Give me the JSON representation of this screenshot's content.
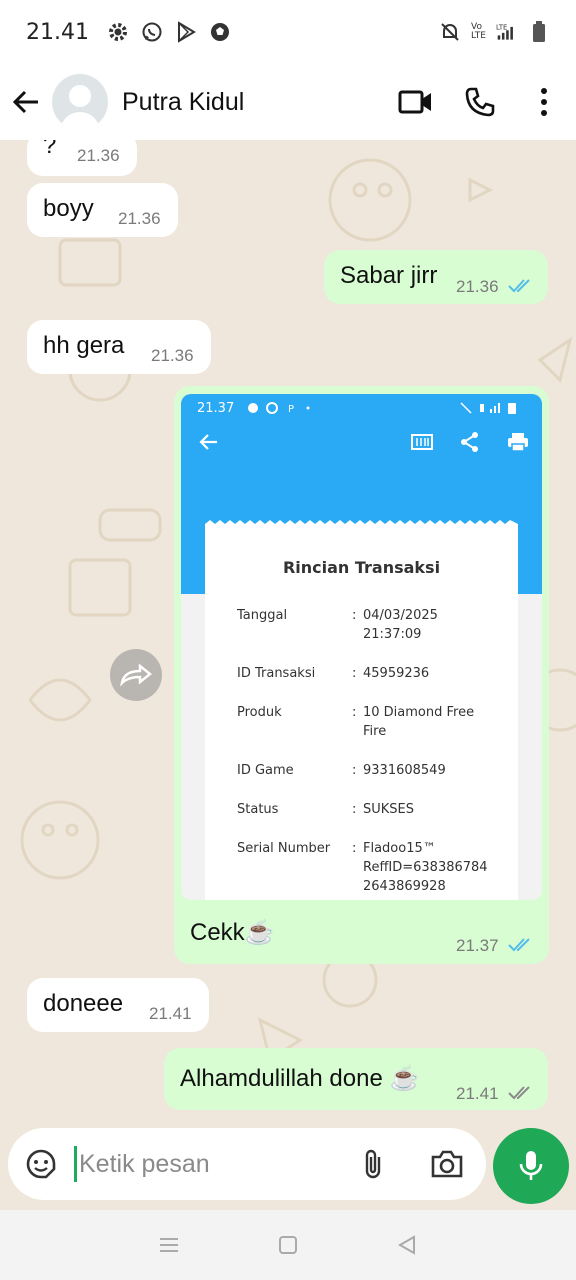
{
  "status_bar": {
    "time": "21.41",
    "lte_label": "Vo\nLTE",
    "lte2_label": "LTE"
  },
  "header": {
    "contact_name": "Putra Kidul"
  },
  "messages": [
    {
      "text": "?",
      "time": "21.36"
    },
    {
      "text": "boyy",
      "time": "21.36"
    },
    {
      "text": "Sabar jirr",
      "time": "21.36"
    },
    {
      "text": "hh gera",
      "time": "21.36"
    },
    {
      "text": "Cekk☕",
      "time": "21.37"
    },
    {
      "text": "doneee",
      "time": "21.41"
    },
    {
      "text": "Alhamdulillah done ☕",
      "time": "21.41"
    }
  ],
  "receipt": {
    "status_time": "21.37",
    "title": "Rincian Transaksi",
    "rows": [
      {
        "label": "Tanggal",
        "value": "04/03/2025\n21:37:09"
      },
      {
        "label": "ID Transaksi",
        "value": "45959236"
      },
      {
        "label": "Produk",
        "value": "10 Diamond Free\nFire"
      },
      {
        "label": "ID Game",
        "value": "9331608549"
      },
      {
        "label": "Status",
        "value": "SUKSES"
      },
      {
        "label": "Serial Number",
        "value": "Fladoo15™\nReffID=638386784\n2643869928"
      }
    ],
    "separator": ":"
  },
  "composer": {
    "placeholder": "Ketik pesan"
  },
  "colors": {
    "accent": "#1fa855",
    "out_bubble": "#d9fdd3",
    "receipt_blue": "#2aa9f4",
    "read_tick": "#53bdeb"
  }
}
